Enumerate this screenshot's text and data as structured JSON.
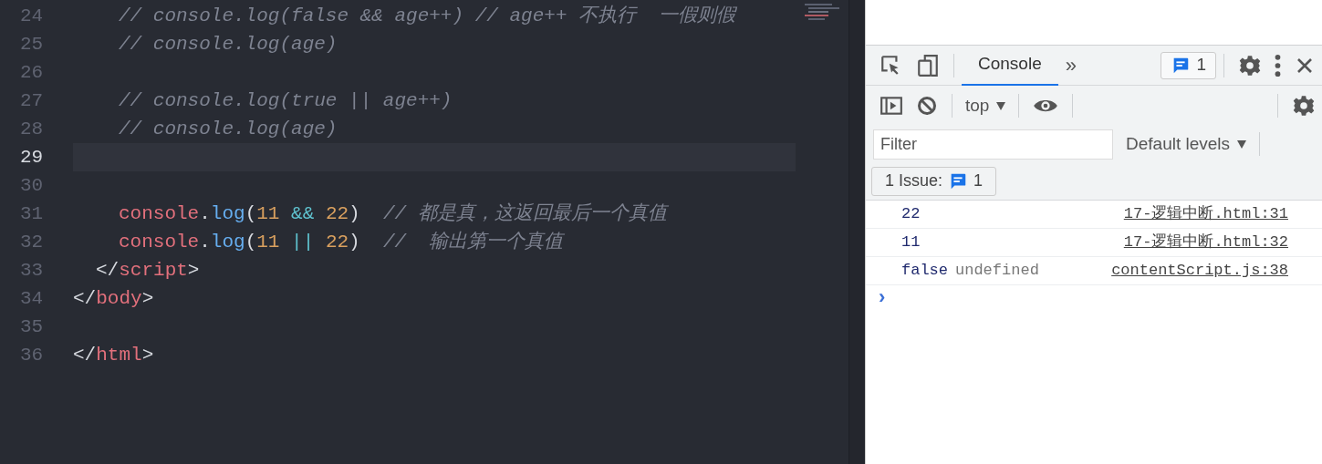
{
  "editor": {
    "lines": [
      {
        "kind": "block",
        "children": [
          {
            "kind": "block",
            "children": [
              {
                "kind": "line",
                "number": "24",
                "current": false,
                "tokens": [
                  {
                    "text": "// console.log(false && age++) // age++ 不执行  一假则假",
                    "kind": "comment"
                  }
                ]
              },
              {
                "kind": "line",
                "number": "25",
                "current": false,
                "tokens": [
                  {
                    "text": "// console.log(age)",
                    "kind": "comment"
                  }
                ]
              },
              {
                "kind": "line",
                "number": "26",
                "current": false
              },
              {
                "kind": "line",
                "number": "27",
                "current": false,
                "tokens": [
                  {
                    "text": "// console.log(true || age++)",
                    "kind": "comment"
                  }
                ]
              },
              {
                "kind": "line",
                "number": "28",
                "current": false,
                "tokens": [
                  {
                    "text": "// console.log(age)",
                    "kind": "comment"
                  }
                ]
              },
              {
                "kind": "line",
                "number": "29",
                "current": true
              },
              {
                "kind": "line",
                "number": "30",
                "current": false
              },
              {
                "kind": "line",
                "number": "31",
                "current": false,
                "tokens": [
                  {
                    "text": "console",
                    "kind": "ident"
                  },
                  {
                    "text": ".",
                    "kind": "plain"
                  },
                  {
                    "text": "log",
                    "kind": "method"
                  },
                  {
                    "text": "(",
                    "kind": "plain"
                  },
                  {
                    "text": "11",
                    "kind": "number"
                  },
                  {
                    "text": "&&",
                    "kind": "operator"
                  },
                  {
                    "text": "22",
                    "kind": "number"
                  },
                  {
                    "text": ")",
                    "kind": "plain"
                  },
                  {
                    "text": "// 都是真，这返回最后一个真值",
                    "kind": "comment"
                  }
                ]
              },
              {
                "kind": "line",
                "number": "32",
                "current": false,
                "tokens": [
                  {
                    "text": "console",
                    "kind": "ident"
                  },
                  {
                    "text": ".",
                    "kind": "plain"
                  },
                  {
                    "text": "log",
                    "kind": "method"
                  },
                  {
                    "text": "(",
                    "kind": "plain"
                  },
                  {
                    "text": "11",
                    "kind": "number"
                  },
                  {
                    "text": "||",
                    "kind": "operator"
                  },
                  {
                    "text": "22",
                    "kind": "number"
                  },
                  {
                    "text": ")",
                    "kind": "plain"
                  },
                  {
                    "text": "//  输出第一个真值",
                    "kind": "comment"
                  }
                ]
              }
            ]
          },
          {
            "kind": "line",
            "number": "33",
            "current": false,
            "tokens": [
              {
                "text": "</",
                "kind": "plain"
              },
              {
                "text": "script",
                "kind": "tag"
              },
              {
                "text": ">",
                "kind": "plain"
              }
            ]
          }
        ]
      },
      {
        "kind": "line",
        "number": "34",
        "current": false,
        "tokens": [
          {
            "text": "</",
            "kind": "plain"
          },
          {
            "text": "body",
            "kind": "tag"
          },
          {
            "text": ">",
            "kind": "plain"
          }
        ]
      },
      {
        "kind": "line",
        "number": "35",
        "current": false
      },
      {
        "kind": "line",
        "number": "36",
        "current": false,
        "tokens": [
          {
            "text": "</",
            "kind": "plain"
          },
          {
            "text": "html",
            "kind": "tag"
          },
          {
            "text": ">",
            "kind": "plain"
          }
        ]
      }
    ]
  },
  "devtools": {
    "tabs": [
      {
        "label": "Console",
        "selected": true
      }
    ],
    "more_tabs": "»",
    "issues_badge": "1",
    "context": "top",
    "filter": {
      "placeholder": "Filter"
    },
    "levels": "Default levels",
    "issues_button": {
      "label": "1 Issue:",
      "count": "1"
    },
    "messages": [
      {
        "parts": [
          {
            "text": "22",
            "kind": "value"
          }
        ],
        "source": "17-逻辑中断.html:31"
      },
      {
        "parts": [
          {
            "text": "11",
            "kind": "value"
          }
        ],
        "source": "17-逻辑中断.html:32"
      },
      {
        "parts": [
          {
            "text": "false",
            "kind": "value"
          },
          {
            "text": "undefined",
            "kind": "undefined"
          }
        ],
        "source": "contentScript.js:38"
      }
    ],
    "prompt": "›"
  }
}
